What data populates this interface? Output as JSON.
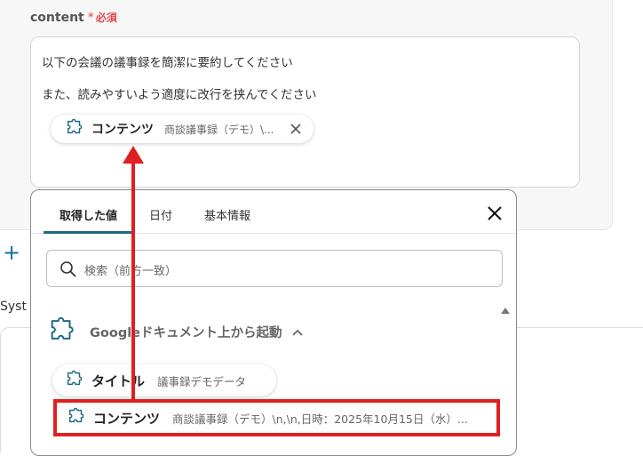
{
  "field": {
    "label": "content",
    "required_star": "*",
    "required_label": "必須",
    "text_line1": "以下の会議の議事録を簡潔に要約してください",
    "text_line2": "また、読みやすいよう適度に改行を挟んでください",
    "inserted_chip": {
      "title": "コンテンツ",
      "value": "商談議事録（デモ）\\..."
    }
  },
  "add_button": "+",
  "next_section_label": "Syst",
  "dropdown": {
    "tabs": [
      {
        "label": "取得した値",
        "active": true
      },
      {
        "label": "日付",
        "active": false
      },
      {
        "label": "基本情報",
        "active": false
      }
    ],
    "search_placeholder": "検索（前方一致）",
    "section_title": "Googleドキュメント上から起動",
    "items": [
      {
        "title": "タイトル",
        "value": "議事録デモデータ"
      },
      {
        "title": "コンテンツ",
        "value": "商談議事録（デモ）\\n,\\n,日時：2025年10月15日（水）..."
      }
    ]
  },
  "colors": {
    "required": "#e5484d",
    "accent": "#1e6a86",
    "plus": "#1a6fa0",
    "highlight": "#e02020",
    "chip_icon": "#1e6a86"
  },
  "icons": [
    "puzzle-icon",
    "close-icon",
    "search-icon",
    "chevron-up-icon",
    "scroll-up-icon"
  ]
}
